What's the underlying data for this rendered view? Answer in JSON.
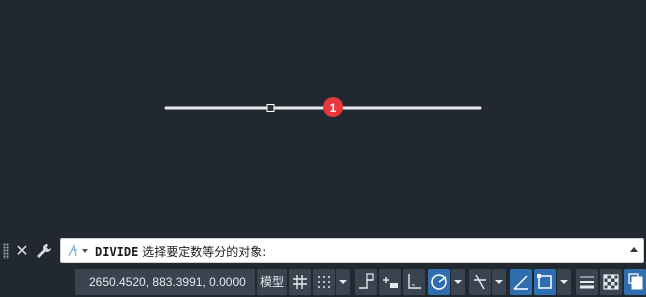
{
  "canvas": {
    "marker_number": "1"
  },
  "command_line": {
    "command": "DIVIDE",
    "prompt": "选择要定数等分的对象:"
  },
  "status_bar": {
    "coordinates": "2650.4520, 883.3991, 0.0000",
    "model_label": "模型",
    "icons": [
      "grid-icon",
      "snap-mode-icon",
      "dropdown-icon",
      "infer-constraints-icon",
      "dynamic-input-icon",
      "ortho-icon",
      "polar-tracking-icon",
      "isometric-icon",
      "object-snap-tracking-icon",
      "object-snap-icon",
      "lineweight-icon",
      "transparency-icon",
      "selection-cycling-icon"
    ],
    "accent_color": "#2f6fb0"
  }
}
